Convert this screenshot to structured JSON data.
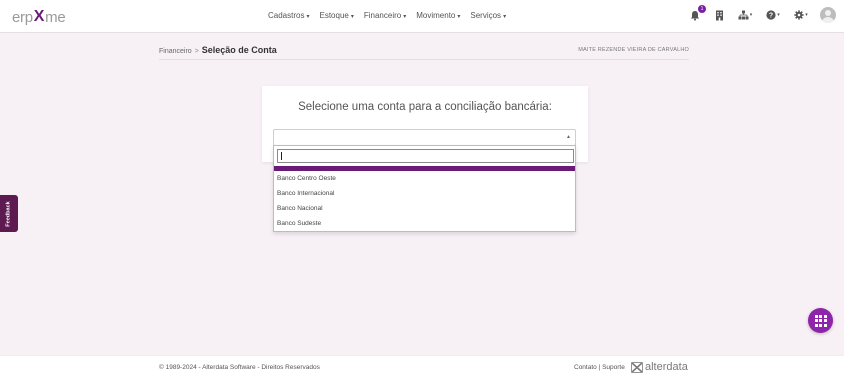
{
  "header": {
    "logo_left": "erp",
    "logo_x": "X",
    "logo_right": "me",
    "nav": [
      {
        "label": "Cadastros"
      },
      {
        "label": "Estoque"
      },
      {
        "label": "Financeiro"
      },
      {
        "label": "Movimento"
      },
      {
        "label": "Serviços"
      }
    ],
    "notification_count": "1"
  },
  "breadcrumb": {
    "parent": "Financeiro",
    "separator": ">",
    "current": "Seleção de Conta"
  },
  "user": {
    "name": "MAITE REZENDE VIEIRA DE CARVALHO"
  },
  "card": {
    "title": "Selecione uma conta para a conciliação bancária:",
    "select_value": ""
  },
  "dropdown": {
    "search_value": "",
    "options": [
      "Banco Centro Oeste",
      "Banco Internacional",
      "Banco Nacional",
      "Banco Sudeste"
    ]
  },
  "feedback": {
    "label": "Feedback"
  },
  "footer": {
    "copyright": "© 1989-2024 - Alterdata Software - Direitos Reservados",
    "links": "Contato | Suporte",
    "brand": "alterdata"
  },
  "colors": {
    "accent": "#6a1b7a",
    "fab": "#8e24aa",
    "feedback": "#5c1a50",
    "background": "#f7f1f6"
  },
  "icons": [
    "bell-icon",
    "building-icon",
    "org-chart-icon",
    "help-icon",
    "gear-icon",
    "avatar",
    "apps-grid-icon"
  ]
}
